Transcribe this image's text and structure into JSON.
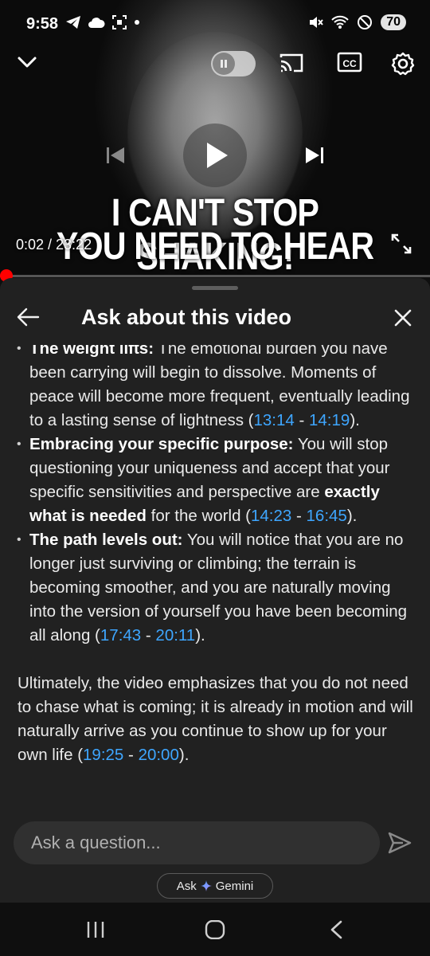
{
  "status": {
    "time": "9:58",
    "left_icons": [
      "telegram-icon",
      "cloud-icon",
      "screenshot-icon",
      "dot-icon"
    ],
    "right_icons": [
      "mute-icon",
      "wifi-icon",
      "do-not-disturb-icon"
    ],
    "battery": "70"
  },
  "video": {
    "title_line1": "I CAN'T STOP SHAKING!",
    "title_line2": "YOU NEED TO HEAR THIS",
    "time_display": "0:02 / 23:22",
    "progress_fraction": 0.0014,
    "state": "paused"
  },
  "sheet": {
    "title": "Ask about this video"
  },
  "answer": {
    "b1_bold": "The weight lifts:",
    "b1_text": " The emotional burden you have been carrying will begin to dissolve. Moments of peace will become more frequent, eventually leading to a lasting sense of lightness (",
    "b1_ts1": "13:14",
    "b1_sep": " - ",
    "b1_ts2": "14:19",
    "b1_end": ").",
    "b2_bold": "Embracing your specific purpose:",
    "b2_text": " You will stop questioning your uniqueness and accept that your specific sensitivities and perspective are ",
    "b2_bold2": "exactly what is needed",
    "b2_text2": " for the world (",
    "b2_ts1": "14:23",
    "b2_sep": " - ",
    "b2_ts2": "16:45",
    "b2_end": ").",
    "b3_bold": "The path levels out:",
    "b3_text": " You will notice that you are no longer just surviving or climbing; the terrain is becoming smoother, and you are naturally moving into the version of yourself you have been becoming all along (",
    "b3_ts1": "17:43",
    "b3_sep": " - ",
    "b3_ts2": "20:11",
    "b3_end": ").",
    "p_text": "Ultimately, the video emphasizes that you do not need to chase what is coming; it is already in motion and will naturally arrive as you continue to show up for your own life (",
    "p_ts1": "19:25",
    "p_sep": " - ",
    "p_ts2": "20:00",
    "p_end": ")."
  },
  "ask": {
    "placeholder": "Ask a question...",
    "gemini_prefix": "Ask",
    "gemini_label": "Gemini"
  },
  "colors": {
    "accent_link": "#3ea6ff",
    "progress": "#ff0000",
    "sheet_bg": "#212121"
  }
}
